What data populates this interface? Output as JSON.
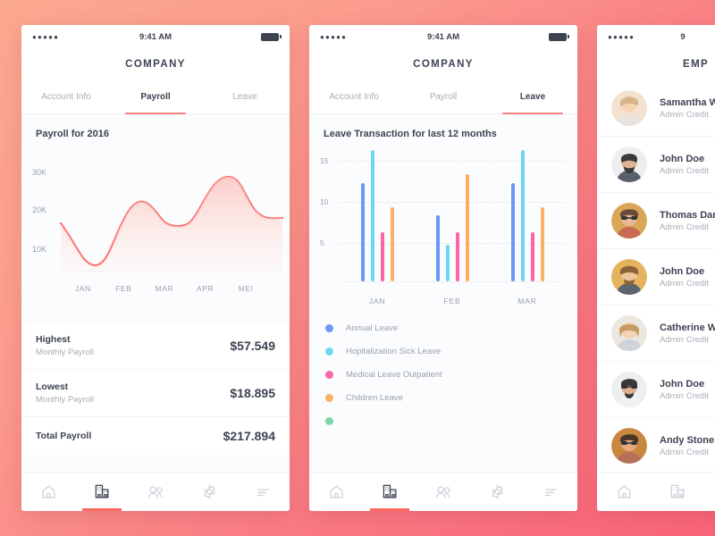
{
  "theme": {
    "accent": "#fb7c7c",
    "active_tab_underline": "#fb6a5f",
    "bg_gradient_from": "#fba98f",
    "bg_gradient_to": "#f9647a",
    "text_dark": "#3d4353",
    "text_muted": "#a8adb8"
  },
  "phones": {
    "payroll": {
      "status": {
        "signal_dots": "●●●●●",
        "time": "9:41 AM",
        "battery_icon": "battery-full-icon"
      },
      "title": "COMPANY",
      "tabs": [
        {
          "label": "Account Info",
          "active": false
        },
        {
          "label": "Payroll",
          "active": true
        },
        {
          "label": "Leave",
          "active": false
        }
      ],
      "chart_title": "Payroll for 2016",
      "stats": [
        {
          "label": "Highest",
          "sub": "Monthly Payroll",
          "value": "$57.549"
        },
        {
          "label": "Lowest",
          "sub": "Monthly Payroll",
          "value": "$18.895"
        },
        {
          "label": "Total Payroll",
          "sub": "",
          "value": "$217.894"
        }
      ]
    },
    "leave": {
      "status": {
        "signal_dots": "●●●●●",
        "time": "9:41 AM",
        "battery_icon": "battery-full-icon"
      },
      "title": "COMPANY",
      "tabs": [
        {
          "label": "Account Info",
          "active": false
        },
        {
          "label": "Payroll",
          "active": false
        },
        {
          "label": "Leave",
          "active": true
        }
      ],
      "chart_title": "Leave Transaction for last 12 months"
    },
    "employees": {
      "status": {
        "signal_dots": "●●●●●",
        "time": "9"
      },
      "title": "EMP",
      "employees": [
        {
          "name": "Samantha Will",
          "role": "Admin Credit",
          "avatar": "avatar-photo"
        },
        {
          "name": "John Doe",
          "role": "Admin Credit",
          "avatar": "avatar-photo"
        },
        {
          "name": "Thomas Danie",
          "role": "Admin Credit",
          "avatar": "avatar-photo"
        },
        {
          "name": "John Doe",
          "role": "Admin Credit",
          "avatar": "avatar-photo"
        },
        {
          "name": "Catherine Will",
          "role": "Admin Credit",
          "avatar": "avatar-photo"
        },
        {
          "name": "John Doe",
          "role": "Admin Credit",
          "avatar": "avatar-photo"
        },
        {
          "name": "Andy Stone",
          "role": "Admin Credit",
          "avatar": "avatar-photo"
        }
      ]
    }
  },
  "tabbar": {
    "items": [
      {
        "icon": "home-icon",
        "active": false
      },
      {
        "icon": "building-icon",
        "active": true
      },
      {
        "icon": "people-icon",
        "active": false
      },
      {
        "icon": "gear-icon",
        "active": false
      },
      {
        "icon": "list-icon",
        "active": false
      }
    ]
  },
  "chart_data": [
    {
      "type": "area",
      "title": "Payroll for 2016",
      "xlabel": "",
      "ylabel": "",
      "categories": [
        "JAN",
        "FEB",
        "MAR",
        "APR",
        "MEI"
      ],
      "values": [
        18000,
        9000,
        22000,
        18500,
        30500
      ],
      "end_value": 20500,
      "ytick_labels": [
        "10K",
        "20K",
        "30K"
      ],
      "yticks": [
        10000,
        20000,
        30000
      ],
      "ylim": [
        0,
        34000
      ],
      "grid": "dotted-horizontal",
      "line_color": "#fb6a6a",
      "fill_color": "#fdd7d4",
      "legend": "none"
    },
    {
      "type": "bar",
      "title": "Leave Transaction for last 12 months",
      "xlabel": "",
      "ylabel": "",
      "categories": [
        "JAN",
        "FEB",
        "MAR"
      ],
      "ytick_labels": [
        "5",
        "10",
        "15"
      ],
      "yticks": [
        5,
        10,
        15
      ],
      "ylim": [
        0,
        17
      ],
      "grid": "dotted-horizontal",
      "legend": "bottom-left",
      "series": [
        {
          "name": "Annual Leave",
          "color": "#6b97f7",
          "values": [
            12,
            8,
            12
          ]
        },
        {
          "name": "Hopitalization Sick Leave",
          "color": "#6ad8f5",
          "values": [
            16,
            4.5,
            16
          ]
        },
        {
          "name": "Medical Leave Outpatient",
          "color": "#fb64a8",
          "values": [
            6,
            6,
            6
          ]
        },
        {
          "name": "Children Leave",
          "color": "#fbb062",
          "values": [
            9,
            13,
            9
          ]
        }
      ]
    }
  ]
}
